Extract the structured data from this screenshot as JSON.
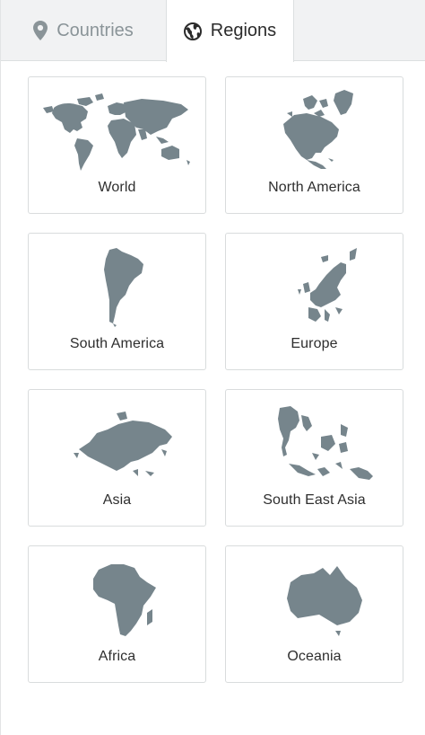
{
  "tabs": [
    {
      "label": "Countries",
      "icon": "map-pin-icon",
      "active": false
    },
    {
      "label": "Regions",
      "icon": "globe-icon",
      "active": true
    }
  ],
  "colors": {
    "land": "#76858c",
    "tab_bar_bg": "#f1f2f3",
    "inactive_tab_text": "#8a9498"
  },
  "regions": [
    {
      "label": "World",
      "icon": "world-map-icon"
    },
    {
      "label": "North America",
      "icon": "north-america-map-icon"
    },
    {
      "label": "South America",
      "icon": "south-america-map-icon"
    },
    {
      "label": "Europe",
      "icon": "europe-map-icon"
    },
    {
      "label": "Asia",
      "icon": "asia-map-icon"
    },
    {
      "label": "South East Asia",
      "icon": "south-east-asia-map-icon"
    },
    {
      "label": "Africa",
      "icon": "africa-map-icon"
    },
    {
      "label": "Oceania",
      "icon": "oceania-map-icon"
    }
  ]
}
